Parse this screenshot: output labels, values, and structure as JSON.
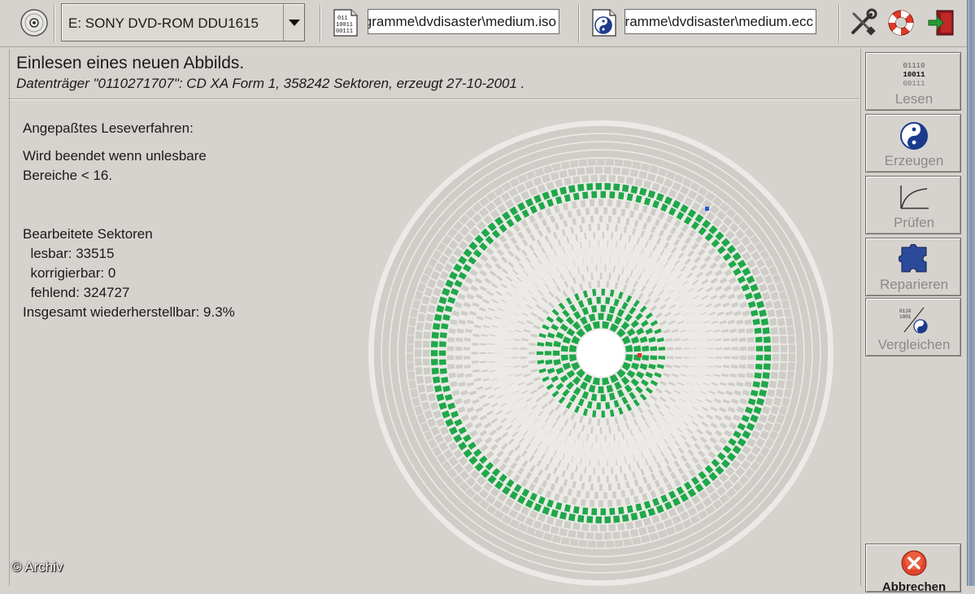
{
  "toolbar": {
    "drive_select_value": "E: SONY DVD-ROM DDU1615",
    "image_file_value": "C:\\Programme\\dvdisaster\\medium.iso",
    "ecc_file_value": "C:\\Programme\\dvdisaster\\medium.ecc",
    "image_file_icon_text": "011\n10011\n00111"
  },
  "header": {
    "title": "Einlesen eines neuen Abbilds.",
    "subtitle": "Datenträger \"0110271707\": CD XA Form 1, 358242 Sektoren, erzeugt 27-10-2001 ."
  },
  "info": {
    "method": "Angepaßtes Leseverfahren:",
    "stop_line1": "Wird beendet wenn unlesbare",
    "stop_line2": "Bereiche < 16.",
    "processed_heading": "Bearbeitete Sektoren",
    "readable": "  lesbar: 33515",
    "correctable": "  korrigierbar: 0",
    "missing": "  fehlend: 324727",
    "recoverable": "Insgesamt wiederherstellbar: 9.3%"
  },
  "disc": {
    "readable_sectors": 33515,
    "missing_sectors": 324727,
    "total_sectors": 358242,
    "colors": {
      "unread": "#cfcdc8",
      "readable": "#1fa84a",
      "error": "#e0302a",
      "cursor": "#1e5bd6",
      "grout": "#eceae6"
    }
  },
  "side_buttons": {
    "read": "Lesen",
    "create": "Erzeugen",
    "verify": "Prüfen",
    "repair": "Reparieren",
    "compare": "Vergleichen",
    "cancel": "Abbrechen",
    "read_icon_text": "01110\n10011\n00111"
  },
  "toolbar_icons": [
    "cd-icon",
    "image-file-icon",
    "ecc-file-icon",
    "tools-icon",
    "lifebuoy-icon",
    "exit-icon"
  ],
  "copyright": "© Archiv"
}
